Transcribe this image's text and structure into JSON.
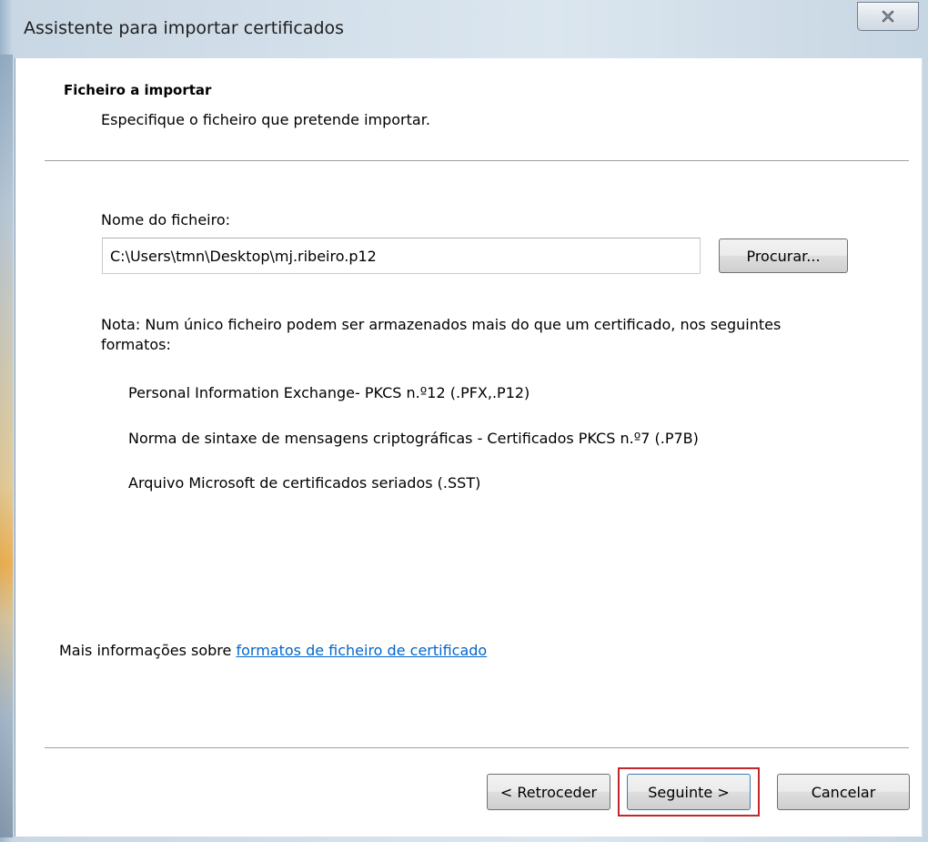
{
  "window": {
    "title": "Assistente para importar certificados"
  },
  "header": {
    "title": "Ficheiro a importar",
    "subtitle": "Especifique o ficheiro que pretende importar."
  },
  "file": {
    "label": "Nome do ficheiro:",
    "value": "C:\\Users\\tmn\\Desktop\\mj.ribeiro.p12",
    "browse_label": "Procurar..."
  },
  "note": {
    "text": "Nota: Num único ficheiro podem ser armazenados mais do que um certificado, nos seguintes formatos:",
    "formats": [
      "Personal Information Exchange- PKCS n.º12 (.PFX,.P12)",
      "Norma de sintaxe de mensagens criptográficas - Certificados PKCS n.º7 (.P7B)",
      "Arquivo Microsoft de certificados seriados (.SST)"
    ]
  },
  "more_info": {
    "prefix": "Mais informações sobre ",
    "link_text": "formatos de ficheiro de certificado"
  },
  "buttons": {
    "back": "< Retroceder",
    "next": "Seguinte >",
    "cancel": "Cancelar"
  },
  "colors": {
    "link": "#0066cc",
    "highlight": "#c0282d"
  },
  "icons": {
    "close": "close-icon"
  }
}
